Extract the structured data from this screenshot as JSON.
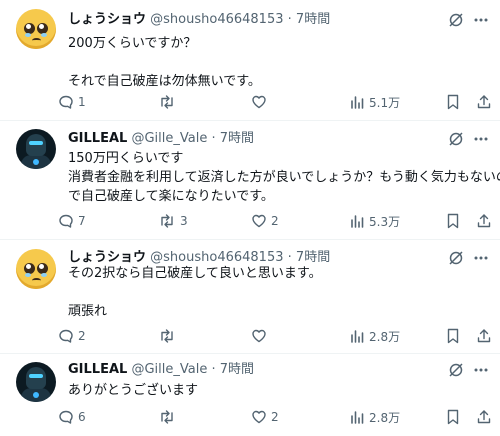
{
  "tweets": [
    {
      "name": "しょうショウ",
      "handle": "@shousho46648153",
      "sep": "·",
      "time": "7時間",
      "lines": [
        "200万くらいですか？",
        "",
        "それで自己破産は勿体無いです。"
      ],
      "counts": {
        "reply": "1",
        "retweet": "",
        "like": "",
        "views": "5.1万"
      }
    },
    {
      "name": "GILLEAL",
      "handle": "@Gille_Vale",
      "sep": "·",
      "time": "7時間",
      "lines": [
        "150万円くらいです",
        "消費者金融を利用して返済した方が良いでしょうか？もう動く気力もないの",
        "で自己破産して楽になりたいです。"
      ],
      "counts": {
        "reply": "7",
        "retweet": "3",
        "like": "2",
        "views": "5.3万"
      }
    },
    {
      "name": "しょうショウ",
      "handle": "@shousho46648153",
      "sep": "·",
      "time": "7時間",
      "lines": [
        "その2択なら自己破産して良いと思います。",
        "",
        "頑張れ"
      ],
      "counts": {
        "reply": "2",
        "retweet": "",
        "like": "",
        "views": "2.8万"
      }
    },
    {
      "name": "GILLEAL",
      "handle": "@Gille_Vale",
      "sep": "·",
      "time": "7時間",
      "lines": [
        "ありがとうございます"
      ],
      "counts": {
        "reply": "6",
        "retweet": "",
        "like": "2",
        "views": "2.8万"
      }
    }
  ]
}
